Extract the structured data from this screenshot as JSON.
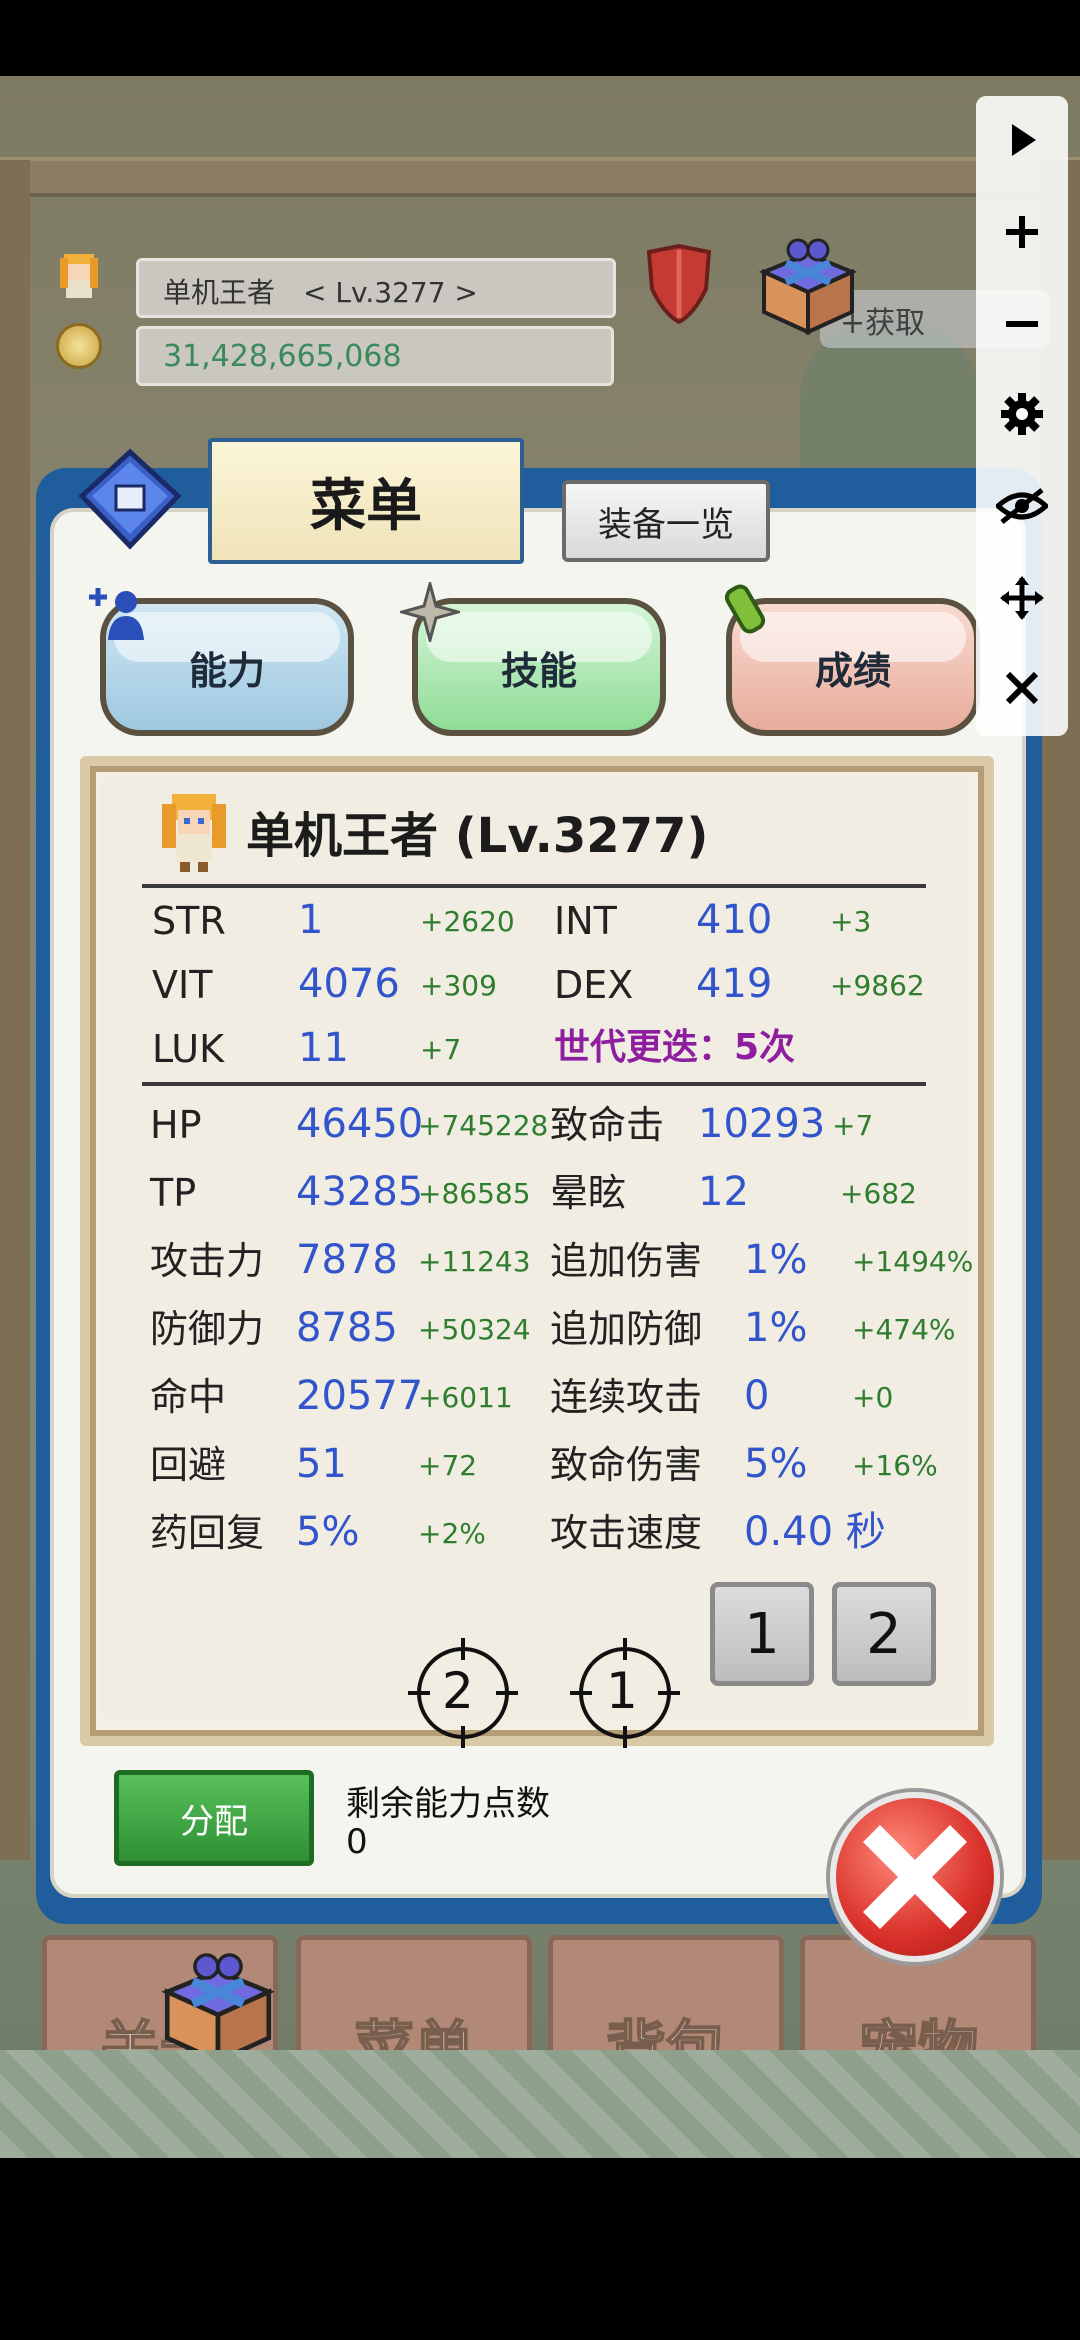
{
  "hud": {
    "player_name": "单机王者　< Lv.3277 >",
    "gold": "31,428,665,068",
    "plus_label": "+获取"
  },
  "bottom_nav": [
    "关卡",
    "菜单",
    "背包",
    "宠物"
  ],
  "sidebar": [
    "play-icon",
    "plus-icon",
    "minus-icon",
    "gear-icon",
    "eye-off-icon",
    "move-icon",
    "close-icon"
  ],
  "panel": {
    "title": "菜单",
    "equip_button": "装备一览",
    "tabs": {
      "ability": "能力",
      "skill": "技能",
      "record": "成绩"
    },
    "character": "单机王者 (Lv.3277)",
    "base_stats": [
      {
        "label": "STR",
        "value": "1",
        "bonus": "+2620"
      },
      {
        "label": "INT",
        "value": "410",
        "bonus": "+3"
      },
      {
        "label": "VIT",
        "value": "4076",
        "bonus": "+309"
      },
      {
        "label": "DEX",
        "value": "419",
        "bonus": "+9862"
      },
      {
        "label": "LUK",
        "value": "11",
        "bonus": "+7"
      }
    ],
    "generation": "世代更迭：5次",
    "combat_stats": [
      {
        "label": "HP",
        "value": "46450",
        "bonus": "+745228"
      },
      {
        "label": "致命击",
        "value": "10293",
        "bonus": "+7"
      },
      {
        "label": "TP",
        "value": "43285",
        "bonus": "+86585"
      },
      {
        "label": "晕眩",
        "value": "12",
        "bonus": "+682"
      },
      {
        "label": "攻击力",
        "value": "7878",
        "bonus": "+11243"
      },
      {
        "label": "追加伤害",
        "value": "1%",
        "bonus": "+1494%"
      },
      {
        "label": "防御力",
        "value": "8785",
        "bonus": "+50324"
      },
      {
        "label": "追加防御",
        "value": "1%",
        "bonus": "+474%"
      },
      {
        "label": "命中",
        "value": "20577",
        "bonus": "+6011"
      },
      {
        "label": "连续攻击",
        "value": "0",
        "bonus": "+0"
      },
      {
        "label": "回避",
        "value": "51",
        "bonus": "+72"
      },
      {
        "label": "致命伤害",
        "value": "5%",
        "bonus": "+16%"
      },
      {
        "label": "药回复",
        "value": "5%",
        "bonus": "+2%"
      },
      {
        "label": "攻击速度",
        "value": "0.40 秒",
        "bonus": ""
      }
    ],
    "page_buttons": [
      "1",
      "2"
    ],
    "targets": [
      "2",
      "1"
    ],
    "assign_button": "分配",
    "remaining_label": "剩余能力点数",
    "remaining_value": "0"
  },
  "colors": {
    "panel_border": "#1f5d9c",
    "stat_value": "#3355cc",
    "stat_bonus": "#2f7d2f",
    "generation": "#8d1ea0"
  }
}
